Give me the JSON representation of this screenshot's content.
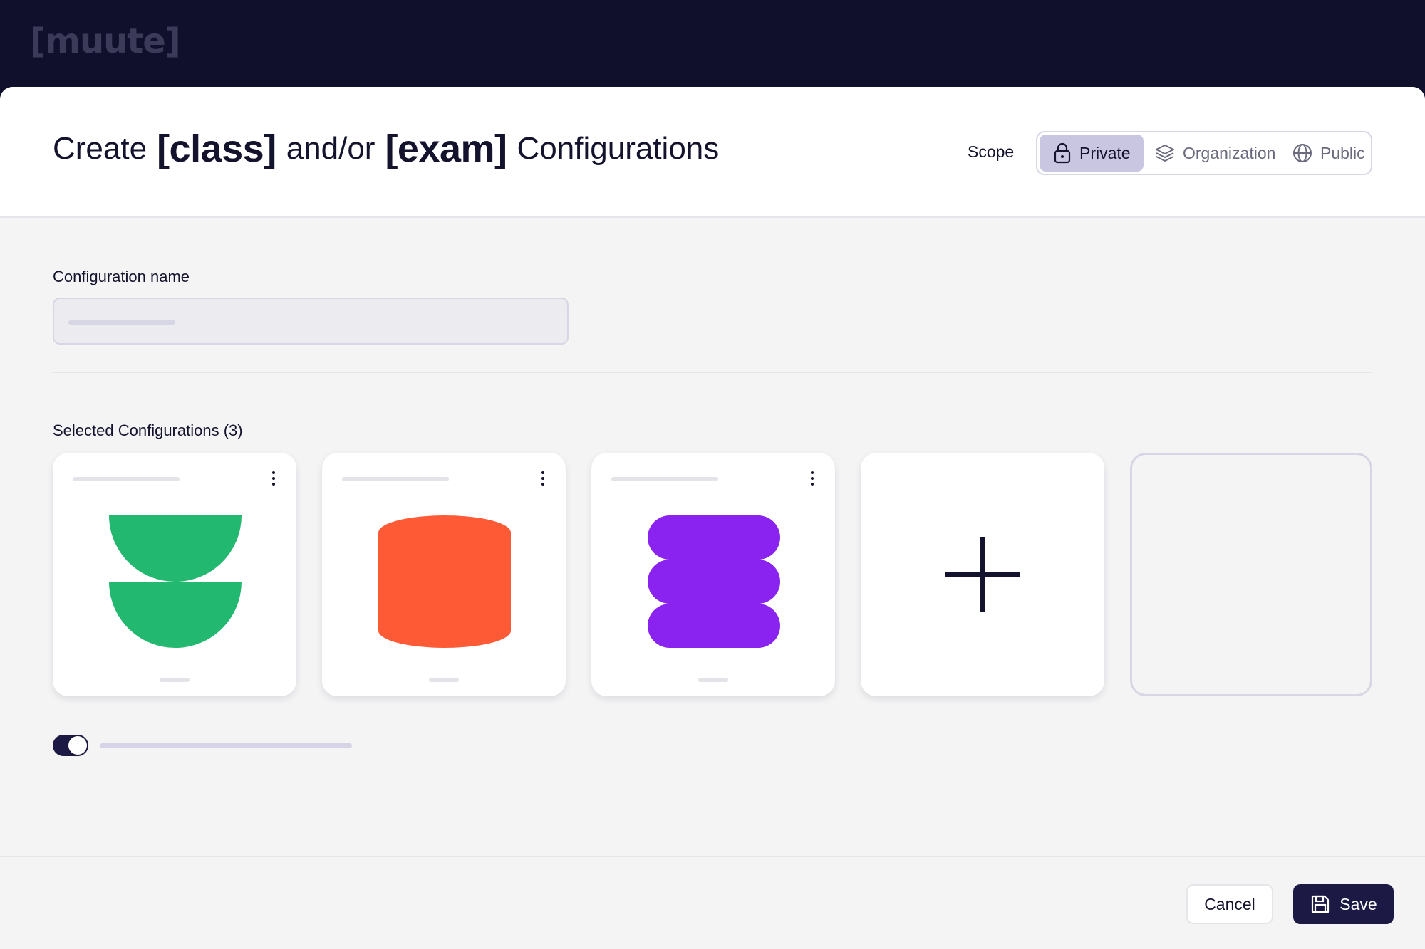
{
  "app": {
    "logo_text": "[muute]"
  },
  "header": {
    "title_part1": "Create",
    "title_bracket1": "[class]",
    "title_part2": "and/or",
    "title_bracket2": "[exam]",
    "title_part3": "Configurations",
    "scope_label": "Scope",
    "scope_options": [
      {
        "label": "Private",
        "icon": "lock-icon",
        "selected": true
      },
      {
        "label": "Organization",
        "icon": "layers-icon",
        "selected": false
      },
      {
        "label": "Public",
        "icon": "globe-icon",
        "selected": false
      }
    ]
  },
  "form": {
    "name_label": "Configuration name",
    "name_value": "",
    "selected_label": "Selected Configurations (3)",
    "cards": [
      {
        "shape": "two-half-circles",
        "color": "#22b86f"
      },
      {
        "shape": "cylinder",
        "color": "#ff5a36"
      },
      {
        "shape": "stacked-pills",
        "color": "#8a22f0"
      }
    ],
    "add_card_icon": "plus-icon",
    "toggle_on": true
  },
  "footer": {
    "cancel_label": "Cancel",
    "save_label": "Save",
    "save_icon": "save-icon"
  },
  "colors": {
    "topbar": "#10102c",
    "primary": "#1c1a45",
    "scope_selected_bg": "#c8c6e0",
    "green": "#22b86f",
    "orange": "#ff5a36",
    "purple": "#8a22f0"
  }
}
